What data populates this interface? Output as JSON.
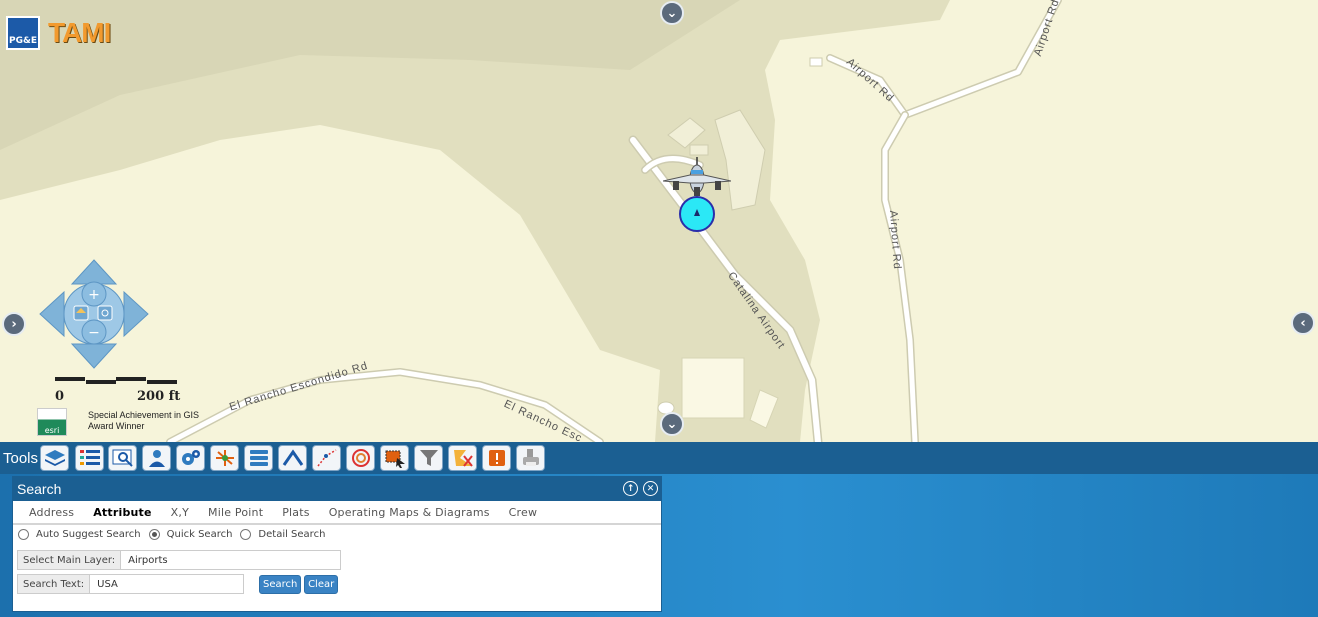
{
  "app": {
    "brand": "PG&E",
    "title": "TAMI"
  },
  "map": {
    "roads": {
      "airport_rd_1": "Airport Rd",
      "airport_rd_2": "Airport Rd",
      "airport_rd_3": "Airport Rd",
      "catalina_airport": "Catalina Airport",
      "el_rancho_1": "El Rancho Escondido Rd",
      "el_rancho_2": "El Rancho Esc"
    },
    "scale": {
      "zero": "0",
      "far": "200 ft"
    },
    "esri_logo": "esri",
    "award": "Special  Achievement in GIS Award Winner"
  },
  "toolbar": {
    "label": "Tools"
  },
  "search_panel": {
    "title": "Search",
    "tabs": [
      "Address",
      "Attribute",
      "X,Y",
      "Mile Point",
      "Plats",
      "Operating Maps & Diagrams",
      "Crew"
    ],
    "active_tab": "Attribute",
    "modes": [
      "Auto Suggest Search",
      "Quick Search",
      "Detail Search"
    ],
    "selected_mode": "Quick Search",
    "main_layer_label": "Select Main Layer:",
    "main_layer_value": "Airports",
    "search_text_label": "Search Text:",
    "search_text_value": "USA",
    "search_button": "Search",
    "clear_button": "Clear"
  },
  "colors": {
    "map_land": "#f6f4da",
    "map_airport": "#e1dfbf",
    "toolbar": "#1b5f92",
    "panel_header": "#1b5f92",
    "button": "#3a83c4",
    "brand_title": "#f29a2e"
  }
}
